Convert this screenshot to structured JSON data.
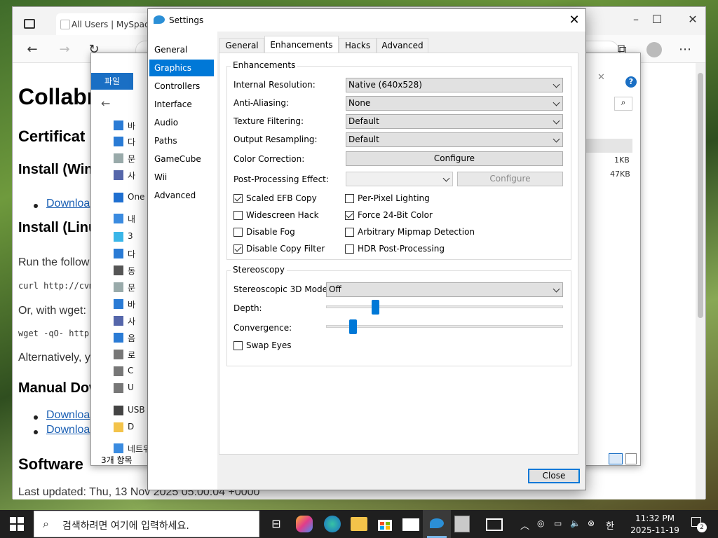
{
  "browser": {
    "tab_title": "All Users | MySpace4",
    "doc": {
      "h1": "Collabr",
      "h2_cert": "Certificat",
      "h3_win": "Install (Win",
      "link_1": "Downloa",
      "h3_linux": "Install (Linu",
      "p_run": "Run the follow",
      "code_curl": "curl http://cvm",
      "p_wget": "Or, with wget:",
      "code_wget": "wget -qO- http:",
      "p_alt": "Alternatively, y",
      "h3_manual": "Manual Dow",
      "link_2": "Downloa",
      "link_3": "Downloa",
      "h2_software": "Software",
      "last_updated": "Last updated: Thu, 13 Nov 2025 05:00:04 +0000"
    }
  },
  "explorer": {
    "menu_file": "파일",
    "sidebar": [
      {
        "icon": "desktop-icon",
        "label": "바"
      },
      {
        "icon": "download-icon",
        "label": "다"
      },
      {
        "icon": "document-icon",
        "label": "문"
      },
      {
        "icon": "picture-icon",
        "label": "사"
      },
      {
        "icon": "onedrive-icon",
        "label": "One"
      },
      {
        "icon": "pc-icon",
        "label": "내"
      },
      {
        "icon": "3d-icon",
        "label": "3"
      },
      {
        "icon": "download-icon",
        "label": "다"
      },
      {
        "icon": "video-icon",
        "label": "동"
      },
      {
        "icon": "document-icon",
        "label": "문"
      },
      {
        "icon": "desktop-icon",
        "label": "바"
      },
      {
        "icon": "picture-icon",
        "label": "사"
      },
      {
        "icon": "music-icon",
        "label": "음"
      },
      {
        "icon": "drive-icon",
        "label": "로"
      },
      {
        "icon": "drive-icon",
        "label": "C"
      },
      {
        "icon": "drive-icon",
        "label": "U"
      },
      {
        "icon": "usb-icon",
        "label": "USB"
      },
      {
        "icon": "folder-icon",
        "label": "D"
      },
      {
        "icon": "network-icon",
        "label": "네트워"
      }
    ],
    "status": "3개 항목",
    "size_1": "1KB",
    "size_2": "47KB"
  },
  "settings": {
    "title": "Settings",
    "sidebar": [
      "General",
      "Graphics",
      "Controllers",
      "Interface",
      "Audio",
      "Paths",
      "GameCube",
      "Wii",
      "Advanced"
    ],
    "selected_sidebar": "Graphics",
    "tabs": [
      "General",
      "Enhancements",
      "Hacks",
      "Advanced"
    ],
    "selected_tab": "Enhancements",
    "enhancements": {
      "group_label": "Enhancements",
      "internal_resolution_label": "Internal Resolution:",
      "internal_resolution_value": "Native (640x528)",
      "anti_aliasing_label": "Anti-Aliasing:",
      "anti_aliasing_value": "None",
      "texture_filtering_label": "Texture Filtering:",
      "texture_filtering_value": "Default",
      "output_resampling_label": "Output Resampling:",
      "output_resampling_value": "Default",
      "color_correction_label": "Color Correction:",
      "configure_label": "Configure",
      "post_processing_label": "Post-Processing Effect:",
      "post_processing_value": "",
      "configure_disabled_label": "Configure",
      "checkboxes": [
        {
          "label": "Scaled EFB Copy",
          "checked": true
        },
        {
          "label": "Per-Pixel Lighting",
          "checked": false
        },
        {
          "label": "Widescreen Hack",
          "checked": false
        },
        {
          "label": "Force 24-Bit Color",
          "checked": true
        },
        {
          "label": "Disable Fog",
          "checked": false
        },
        {
          "label": "Arbitrary Mipmap Detection",
          "checked": false
        },
        {
          "label": "Disable Copy Filter",
          "checked": true
        },
        {
          "label": "HDR Post-Processing",
          "checked": false
        }
      ]
    },
    "stereoscopy": {
      "group_label": "Stereoscopy",
      "mode_label": "Stereoscopic 3D Mode:",
      "mode_value": "Off",
      "depth_label": "Depth:",
      "depth_level": 0.2,
      "convergence_label": "Convergence:",
      "convergence_level": 0.1,
      "swap_eyes_label": "Swap Eyes",
      "swap_eyes_checked": false
    },
    "close_label": "Close"
  },
  "taskbar": {
    "search_placeholder": "검색하려면 여기에 입력하세요.",
    "clock_time": "11:32 PM",
    "clock_date": "2025-11-19",
    "ime_label": "한",
    "notification_count": "2",
    "accent": "#0078d7"
  }
}
